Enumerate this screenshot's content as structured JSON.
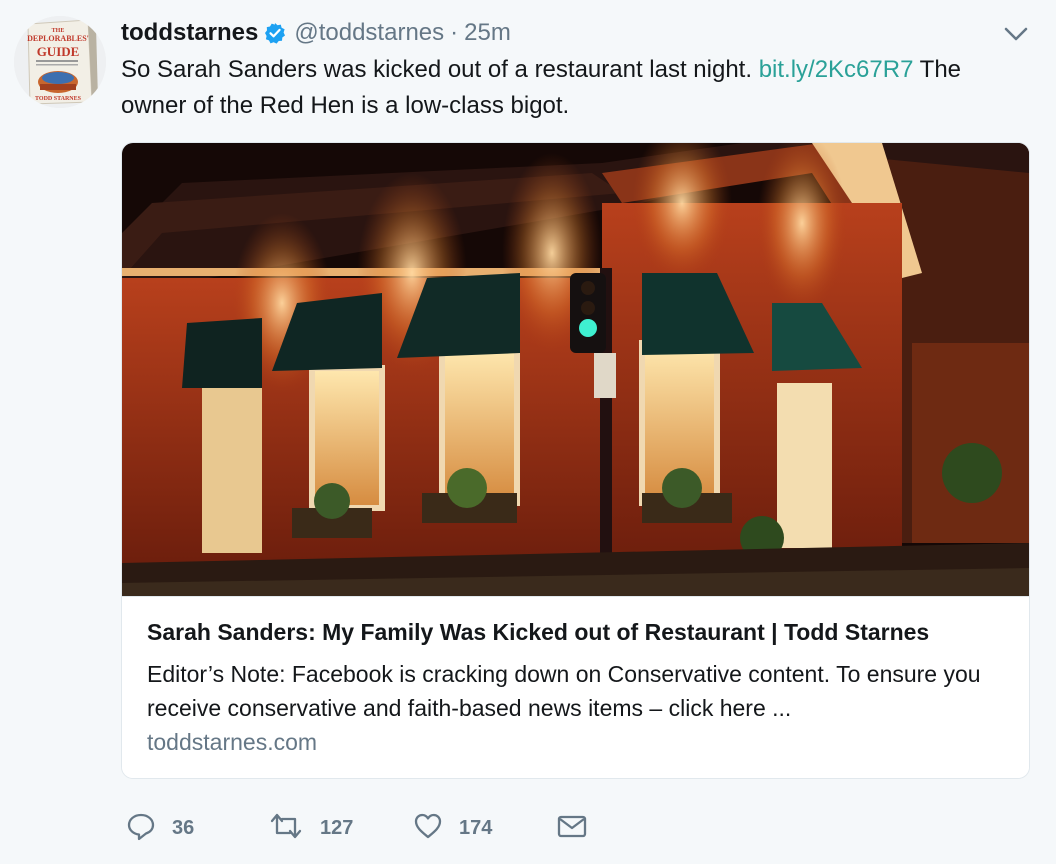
{
  "user": {
    "display_name": "toddstarnes",
    "handle": "@toddstarnes",
    "separator": "·",
    "time": "25m",
    "avatar_icon": "book-cover-avatar",
    "avatar_lines": [
      "THE",
      "DEPLORABLES'",
      "GUIDE",
      "TODD STARNES"
    ]
  },
  "tweet": {
    "text_before": "So Sarah Sanders was kicked out of a restaurant last night. ",
    "link": "bit.ly/2Kc67R7",
    "text_after": " The owner of the Red Hen is a low-class bigot."
  },
  "card": {
    "image_icon": "restaurant-photo",
    "title": "Sarah Sanders: My Family Was Kicked out of Restaurant | Todd Starnes",
    "description": "Editor’s Note: Facebook is cracking down on Conservative content. To ensure you receive conservative and faith-based news items – click here ...",
    "domain": "toddstarnes.com"
  },
  "actions": {
    "replies": "36",
    "retweets": "127",
    "likes": "174"
  },
  "colors": {
    "link": "#2aa198",
    "verified": "#1da1f2",
    "muted": "#657786",
    "text": "#14171a"
  }
}
